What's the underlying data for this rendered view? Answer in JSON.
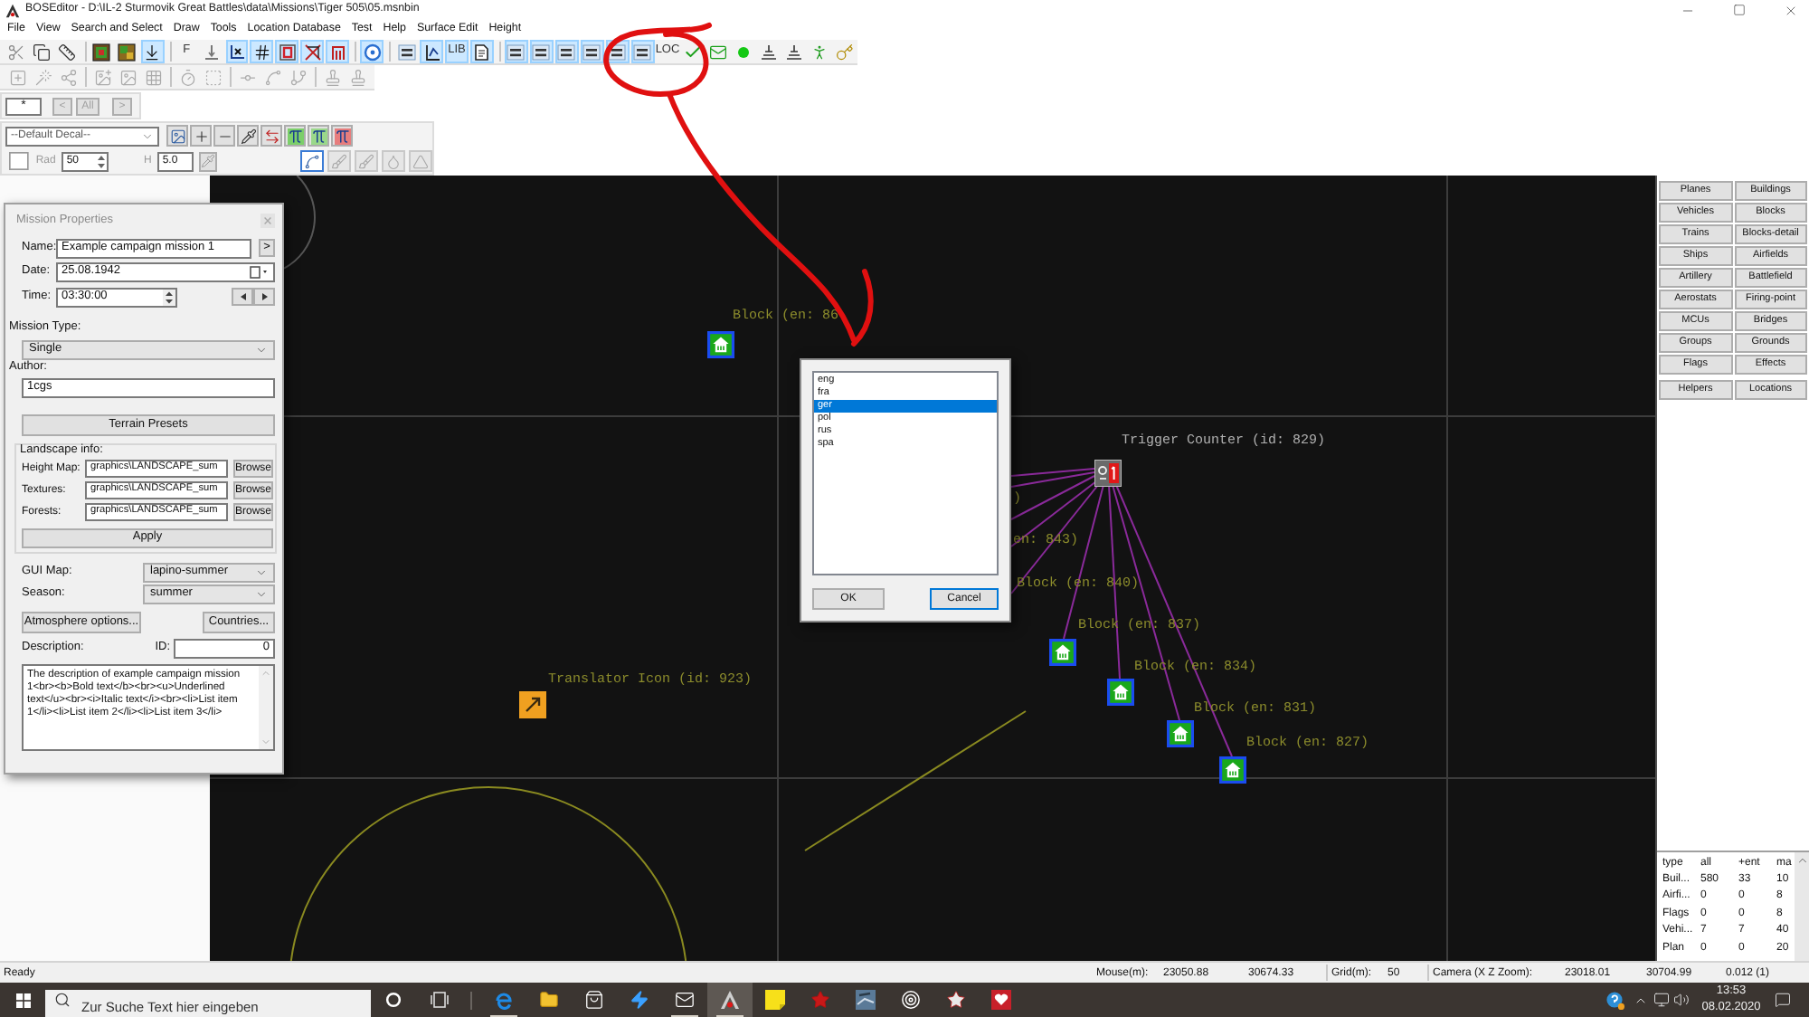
{
  "window": {
    "title": "BOSEditor - D:\\IL-2 Sturmovik Great Battles\\data\\Missions\\Tiger 505\\05.msnbin"
  },
  "menu": [
    "File",
    "View",
    "Search and Select",
    "Draw",
    "Tools",
    "Location Database",
    "Test",
    "Help",
    "Surface Edit",
    "Height"
  ],
  "toolbar_main": [
    [
      {
        "selected": false
      },
      {
        "selected": false
      },
      {
        "selected": false
      }
    ],
    [
      {
        "selected": false
      },
      {
        "selected": false
      },
      {
        "selected": true
      }
    ],
    [
      {
        "label": "F",
        "selected": false
      },
      {
        "selected": false
      },
      {
        "selected": true
      },
      {
        "selected": true
      },
      {
        "selected": true
      },
      {
        "selected": true
      },
      {
        "selected": true
      }
    ],
    [
      {
        "selected": true
      }
    ],
    [
      {
        "selected": false
      },
      {
        "selected": true
      },
      {
        "label": "LIB",
        "selected": true
      },
      {
        "selected": true
      }
    ],
    [
      {
        "selected": true
      },
      {
        "selected": true
      },
      {
        "selected": true
      },
      {
        "selected": true
      },
      {
        "selected": true
      },
      {
        "selected": true
      },
      {
        "label": "LOC",
        "selected": false
      },
      {
        "selected": false
      },
      {
        "selected": false
      },
      {
        "selected": false
      },
      {
        "selected": false
      },
      {
        "selected": false
      },
      {
        "selected": false
      },
      {
        "selected": false
      }
    ]
  ],
  "toolbar_edit": [
    [
      {
        "disabled": true
      },
      {
        "disabled": true
      },
      {
        "disabled": true
      }
    ],
    [
      {
        "disabled": true
      },
      {
        "disabled": true
      },
      {
        "disabled": true
      }
    ],
    [
      {
        "disabled": true
      },
      {
        "disabled": true
      }
    ],
    [
      {
        "disabled": true
      },
      {
        "disabled": true
      },
      {
        "disabled": true
      }
    ],
    [
      {
        "disabled": true
      },
      {
        "disabled": true
      }
    ]
  ],
  "filter_bar": {
    "value": "*",
    "buttons": [
      {
        "label": "<",
        "disabled": true
      },
      {
        "label": "All",
        "disabled": true
      },
      {
        "label": ">",
        "disabled": true
      }
    ]
  },
  "decal_bar": {
    "value": "--Default Decal--"
  },
  "brush_bar": {
    "disabled": true,
    "rad_label": "Rad",
    "rad": "50",
    "h_label": "H",
    "h": "5.0"
  },
  "mission_properties": {
    "title": "Mission Properties",
    "name": {
      "label": "Name:",
      "value": "Example campaign mission 1",
      "button": ">"
    },
    "date": {
      "label": "Date:",
      "value": "25.08.1942"
    },
    "time": {
      "label": "Time:",
      "value": "03:30:00"
    },
    "mission_type": {
      "label": "Mission Type:",
      "value": "Single"
    },
    "author": {
      "label": "Author:",
      "value": "1cgs"
    },
    "terrain_presets": "Terrain Presets",
    "landscape": {
      "title": "Landscape info:",
      "rows": [
        {
          "label": "Height Map:",
          "value": "graphics\\LANDSCAPE_sum",
          "button": "Browse"
        },
        {
          "label": "Textures:",
          "value": "graphics\\LANDSCAPE_sum",
          "button": "Browse"
        },
        {
          "label": "Forests:",
          "value": "graphics\\LANDSCAPE_sum",
          "button": "Browse"
        }
      ],
      "apply": "Apply"
    },
    "gui_map": {
      "label": "GUI Map:",
      "value": "lapino-summer"
    },
    "season": {
      "label": "Season:",
      "value": "summer"
    },
    "buttons": [
      "Atmosphere options...",
      "Countries..."
    ],
    "description": {
      "label": "Description:",
      "text": "The description of example campaign mission 1<br><b>Bold text</b><br><u>Underlined text</u><br><i>Italic text</i><br><li>List item 1</li><li>List item 2</li><li>List item 3</li>"
    },
    "id": {
      "label": "ID:",
      "value": "0"
    }
  },
  "canvas": {
    "objects": [
      {
        "kind": "block",
        "label": "Block (en: 86"
      },
      {
        "kind": "trigger",
        "label": "Trigger Counter (id: 829)"
      },
      {
        "kind": "label",
        "label": ")"
      },
      {
        "kind": "label",
        "label": "en: 843)"
      },
      {
        "kind": "label",
        "label": "Block (en: 840)"
      },
      {
        "kind": "block",
        "label": "Block (en: 837)"
      },
      {
        "kind": "translator",
        "label": "Translator Icon (id: 923)"
      },
      {
        "kind": "block",
        "label": "Block (en: 834)"
      },
      {
        "kind": "block",
        "label": "Block (en: 831)"
      },
      {
        "kind": "block",
        "label": "Block (en: 827)"
      }
    ]
  },
  "language_dialog": {
    "items": [
      {
        "label": "eng",
        "selected": false
      },
      {
        "label": "fra",
        "selected": false
      },
      {
        "label": "ger",
        "selected": true
      },
      {
        "label": "pol",
        "selected": false
      },
      {
        "label": "rus",
        "selected": false
      },
      {
        "label": "spa",
        "selected": false
      }
    ],
    "buttons": [
      {
        "label": "OK",
        "focused": false
      },
      {
        "label": "Cancel",
        "focused": true
      }
    ]
  },
  "object_types": [
    [
      "Planes",
      "Buildings"
    ],
    [
      "Vehicles",
      "Blocks"
    ],
    [
      "Trains",
      "Blocks-detail"
    ],
    [
      "Ships",
      "Airfields"
    ],
    [
      "Artillery",
      "Battlefield"
    ],
    [
      "Aerostats",
      "Firing-point"
    ],
    [
      "MCUs",
      "Bridges"
    ],
    [
      "Groups",
      "Grounds"
    ],
    [
      "Flags",
      "Effects"
    ],
    [
      "Helpers",
      "Locations"
    ]
  ],
  "object_stats": {
    "columns": [
      "type",
      "all",
      "+ent",
      "ma"
    ],
    "rows": [
      [
        "Buil...",
        "580",
        "33",
        "10"
      ],
      [
        "Airfi...",
        "0",
        "0",
        "8"
      ],
      [
        "Flags",
        "0",
        "0",
        "8"
      ],
      [
        "Vehi...",
        "7",
        "7",
        "40"
      ],
      [
        "Plan",
        "0",
        "0",
        "20"
      ]
    ]
  },
  "status_bar": {
    "message": "Ready",
    "groups": [
      [
        "Mouse(m):",
        "23050.88",
        "30674.33"
      ],
      [
        "Grid(m):",
        "50"
      ],
      [
        "Camera (X Z Zoom):",
        "23018.01",
        "30704.99",
        "0.012 (1)"
      ]
    ]
  },
  "taskbar": {
    "search": {
      "placeholder": "Zur Suche Text hier eingeben"
    },
    "apps": [
      {
        "running": true,
        "active": false
      },
      {
        "running": false,
        "active": false
      },
      {
        "running": false,
        "active": false
      },
      {
        "running": false,
        "active": false
      },
      {
        "running": true,
        "active": false
      },
      {
        "running": true,
        "active": true
      },
      {
        "running": false,
        "active": false
      },
      {
        "running": false,
        "active": false
      },
      {
        "running": false,
        "active": false
      },
      {
        "running": false,
        "active": false
      },
      {
        "running": false,
        "active": false
      },
      {
        "running": false,
        "active": false
      }
    ],
    "clock": {
      "time": "13:53",
      "date": "08.02.2020"
    }
  }
}
